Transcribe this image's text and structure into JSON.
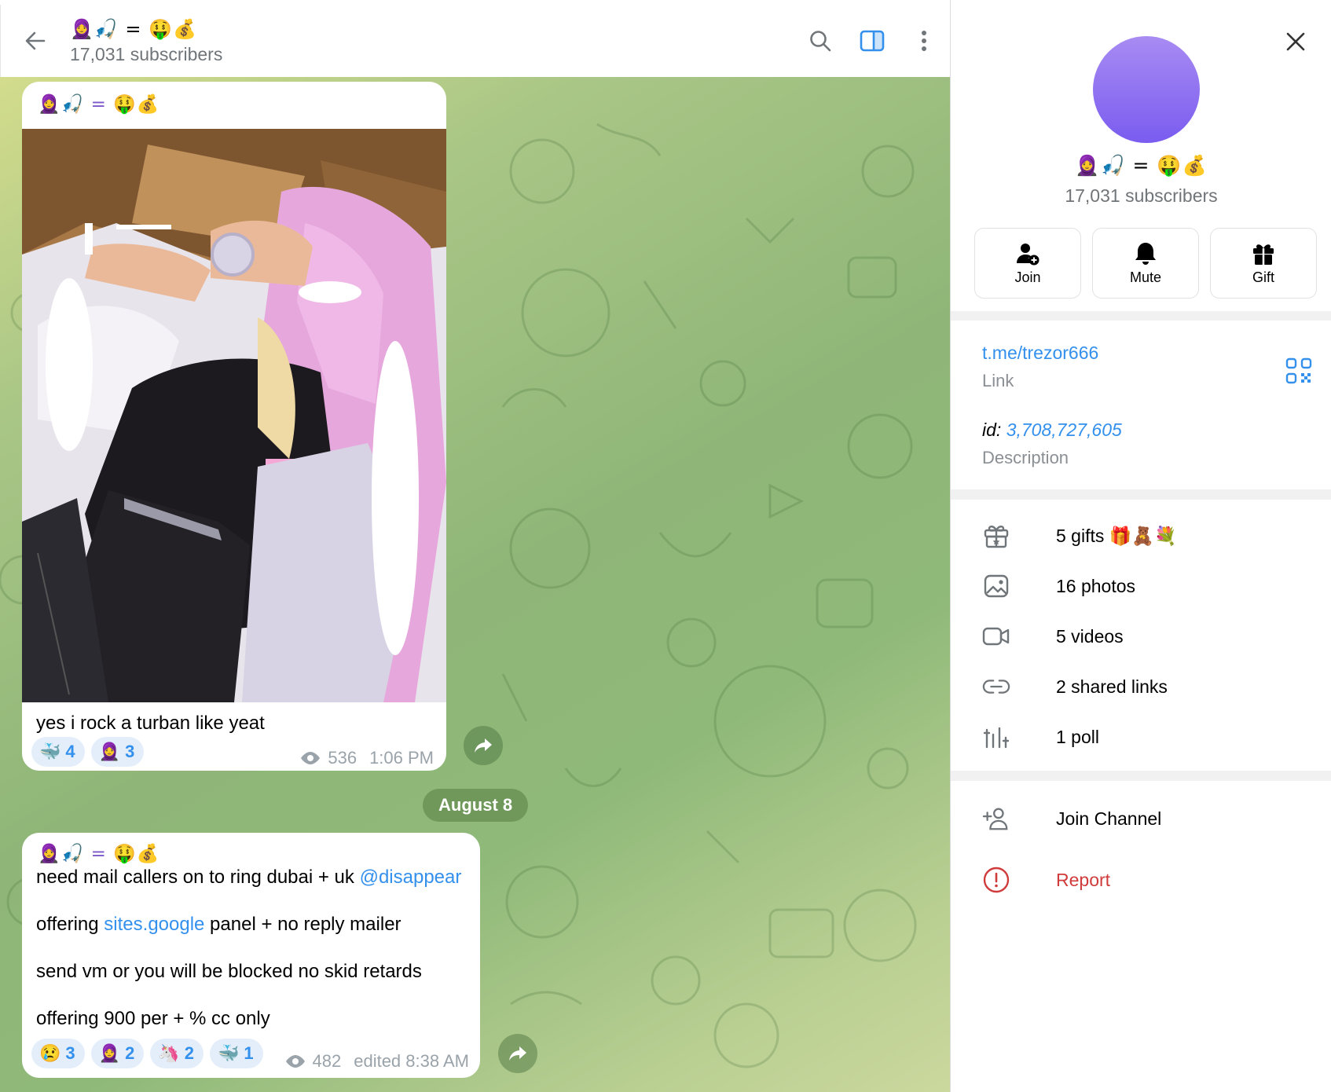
{
  "header": {
    "title": "🧕🎣 = 🤑💰",
    "subscribers": "17,031 subscribers"
  },
  "messages": [
    {
      "author": "🧕🎣 = 🤑💰",
      "text": "yes i rock a turban like yeat",
      "reactions": [
        {
          "emoji": "🐳",
          "count": "4"
        },
        {
          "emoji": "🧕",
          "count": "3"
        }
      ],
      "views": "536",
      "time": "1:06 PM"
    },
    {
      "author": "🧕🎣 = 🤑💰",
      "lines": [
        {
          "pre": "need mail callers on to ring dubai + uk ",
          "link": "@disappear",
          "post": ""
        },
        {
          "pre": "offering ",
          "link": "sites.google",
          "post": " panel + no reply mailer"
        },
        {
          "pre": "send vm or you will be blocked no skid retards",
          "link": "",
          "post": ""
        },
        {
          "pre": "offering 900 per + % cc only",
          "link": "",
          "post": ""
        }
      ],
      "reactions": [
        {
          "emoji": "😢",
          "count": "3"
        },
        {
          "emoji": "🧕",
          "count": "2"
        },
        {
          "emoji": "🦄",
          "count": "2"
        },
        {
          "emoji": "🐳",
          "count": "1"
        }
      ],
      "views": "482",
      "time": "edited 8:38 AM"
    }
  ],
  "date_separator": "August 8",
  "panel": {
    "title": "🧕🎣 = 🤑💰",
    "subscribers": "17,031 subscribers",
    "actions": [
      {
        "label": "Join",
        "icon": "add-user-icon"
      },
      {
        "label": "Mute",
        "icon": "bell-icon"
      },
      {
        "label": "Gift",
        "icon": "gift-icon"
      }
    ],
    "link": "t.me/trezor666",
    "link_label": "Link",
    "id_prefix": "id: ",
    "id_value": "3,708,727,605",
    "description_label": "Description",
    "media": [
      {
        "text": "5 gifts",
        "extra": "🎁🧸💐",
        "icon": "gift-box-icon"
      },
      {
        "text": "16 photos",
        "icon": "photo-icon"
      },
      {
        "text": "5 videos",
        "icon": "video-icon"
      },
      {
        "text": "2 shared links",
        "icon": "link-icon"
      },
      {
        "text": "1 poll",
        "icon": "poll-icon"
      }
    ],
    "join_channel": "Join Channel",
    "report": "Report"
  },
  "colors": {
    "accent": "#3390ec",
    "danger": "#d03b3b",
    "avatar": "#8a6cf0"
  }
}
